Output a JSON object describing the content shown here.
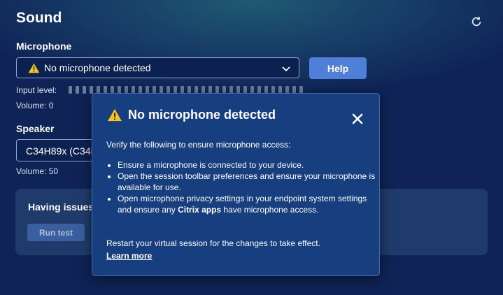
{
  "page": {
    "title": "Sound",
    "refresh_icon": "refresh-icon"
  },
  "microphone": {
    "label": "Microphone",
    "selected_value": "No microphone detected",
    "warning_icon": "warning-icon",
    "help_label": "Help",
    "input_level_label": "Input level:",
    "volume_text": "Volume: 0"
  },
  "speaker": {
    "label": "Speaker",
    "selected_value": "C34H89x (C34H89x)",
    "volume_text": "Volume: 50"
  },
  "issues": {
    "title": "Having issues?",
    "run_test_label": "Run test"
  },
  "popup": {
    "title": "No microphone detected",
    "intro": "Verify the following to ensure microphone access:",
    "items": [
      {
        "pre": "Ensure a microphone is connected to your device.",
        "bold": "",
        "post": ""
      },
      {
        "pre": "Open the session toolbar preferences and ensure your microphone is available for use.",
        "bold": "",
        "post": ""
      },
      {
        "pre": "Open microphone privacy settings in your endpoint system settings and ensure any ",
        "bold": "Citrix apps",
        "post": " have microphone access."
      }
    ],
    "restart_text": "Restart your virtual session for the changes to take effect.",
    "learn_more": "Learn more"
  },
  "colors": {
    "background": "#0f2356",
    "accent_button": "#4f7fd6",
    "warning": "#f2c522",
    "popup_bg": "#173e7e"
  }
}
